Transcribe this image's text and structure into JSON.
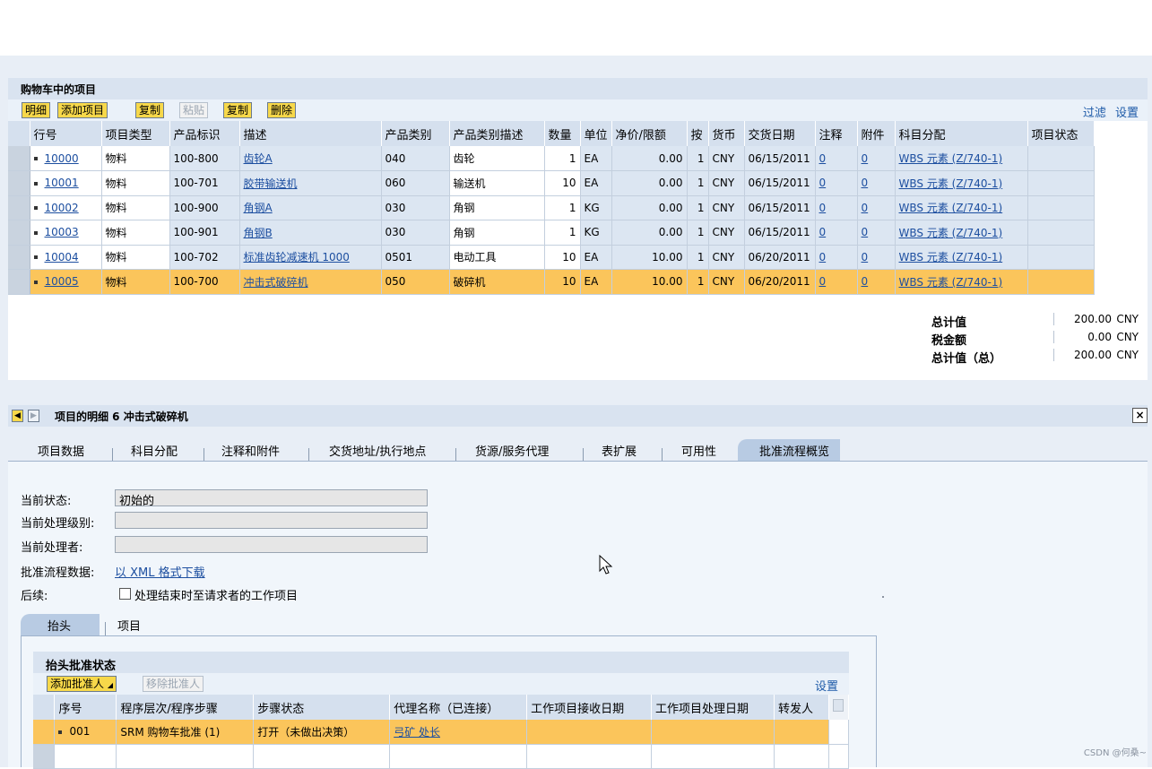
{
  "cart": {
    "title": "购物车中的项目",
    "toolbar": {
      "detail": "明细",
      "add_item": "添加项目",
      "copy1": "复制",
      "paste": "粘贴",
      "copy2": "复制",
      "delete": "删除",
      "filter": "过滤",
      "settings": "设置"
    },
    "columns": [
      "行号",
      "项目类型",
      "产品标识",
      "描述",
      "产品类别",
      "产品类别描述",
      "数量",
      "单位",
      "净价/限额",
      "按",
      "货币",
      "交货日期",
      "注释",
      "附件",
      "科目分配",
      "项目状态"
    ],
    "rows": [
      {
        "line": "10000",
        "type": "物料",
        "product": "100-800",
        "desc": "齿轮A",
        "cat": "040",
        "catdesc": "齿轮",
        "qty": "1",
        "unit": "EA",
        "price": "0.00",
        "per": "1",
        "cur": "CNY",
        "date": "06/15/2011",
        "note": "0",
        "att": "0",
        "acct": "WBS 元素 (Z/740-1)",
        "status": ""
      },
      {
        "line": "10001",
        "type": "物料",
        "product": "100-701",
        "desc": "胶带输送机",
        "cat": "060",
        "catdesc": "输送机",
        "qty": "10",
        "unit": "EA",
        "price": "0.00",
        "per": "1",
        "cur": "CNY",
        "date": "06/15/2011",
        "note": "0",
        "att": "0",
        "acct": "WBS 元素 (Z/740-1)",
        "status": ""
      },
      {
        "line": "10002",
        "type": "物料",
        "product": "100-900",
        "desc": "角钢A",
        "cat": "030",
        "catdesc": "角钢",
        "qty": "1",
        "unit": "KG",
        "price": "0.00",
        "per": "1",
        "cur": "CNY",
        "date": "06/15/2011",
        "note": "0",
        "att": "0",
        "acct": "WBS 元素 (Z/740-1)",
        "status": ""
      },
      {
        "line": "10003",
        "type": "物料",
        "product": "100-901",
        "desc": "角钢B",
        "cat": "030",
        "catdesc": "角钢",
        "qty": "1",
        "unit": "KG",
        "price": "0.00",
        "per": "1",
        "cur": "CNY",
        "date": "06/15/2011",
        "note": "0",
        "att": "0",
        "acct": "WBS 元素 (Z/740-1)",
        "status": ""
      },
      {
        "line": "10004",
        "type": "物料",
        "product": "100-702",
        "desc": "标准齿轮减速机 1000",
        "cat": "0501",
        "catdesc": "电动工具",
        "qty": "10",
        "unit": "EA",
        "price": "10.00",
        "per": "1",
        "cur": "CNY",
        "date": "06/20/2011",
        "note": "0",
        "att": "0",
        "acct": "WBS 元素 (Z/740-1)",
        "status": ""
      },
      {
        "line": "10005",
        "type": "物料",
        "product": "100-700",
        "desc": "冲击式破碎机",
        "cat": "050",
        "catdesc": "破碎机",
        "qty": "10",
        "unit": "EA",
        "price": "10.00",
        "per": "1",
        "cur": "CNY",
        "date": "06/20/2011",
        "note": "0",
        "att": "0",
        "acct": "WBS 元素 (Z/740-1)",
        "status": ""
      }
    ],
    "totals": [
      {
        "label": "总计值",
        "value": "200.00",
        "cur": "CNY"
      },
      {
        "label": "税金额",
        "value": "0.00",
        "cur": "CNY"
      },
      {
        "label": "总计值（总）",
        "value": "200.00",
        "cur": "CNY"
      }
    ]
  },
  "details": {
    "title": "项目的明细 6 冲击式破碎机",
    "close": "×",
    "tabs": [
      "项目数据",
      "科目分配",
      "注释和附件",
      "交货地址/执行地点",
      "货源/服务代理",
      "表扩展",
      "可用性",
      "批准流程概览"
    ],
    "fields": {
      "status_label": "当前状态:",
      "status_value": "初始的",
      "level_label": "当前处理级别:",
      "level_value": "",
      "processor_label": "当前处理者:",
      "processor_value": "",
      "data_label": "批准流程数据:",
      "data_link": "以 XML 格式下载",
      "follow_label": "后续:",
      "follow_checkbox": "处理结束时至请求者的工作项目"
    },
    "subtabs": [
      "抬头",
      "项目"
    ],
    "approval": {
      "title": "抬头批准状态",
      "add_approver": "添加批准人",
      "remove_approver": "移除批准人",
      "settings": "设置",
      "columns": [
        "序号",
        "程序层次/程序步骤",
        "步骤状态",
        "代理名称（已连接）",
        "工作项目接收日期",
        "工作项目处理日期",
        "转发人"
      ],
      "rows": [
        {
          "no": "001",
          "step": "SRM 购物车批准 (1)",
          "state": "打开（未做出决策）",
          "agent": "弓矿 处长",
          "recv": "",
          "proc": "",
          "fwd": ""
        }
      ]
    }
  },
  "watermark": "CSDN @何桑~"
}
